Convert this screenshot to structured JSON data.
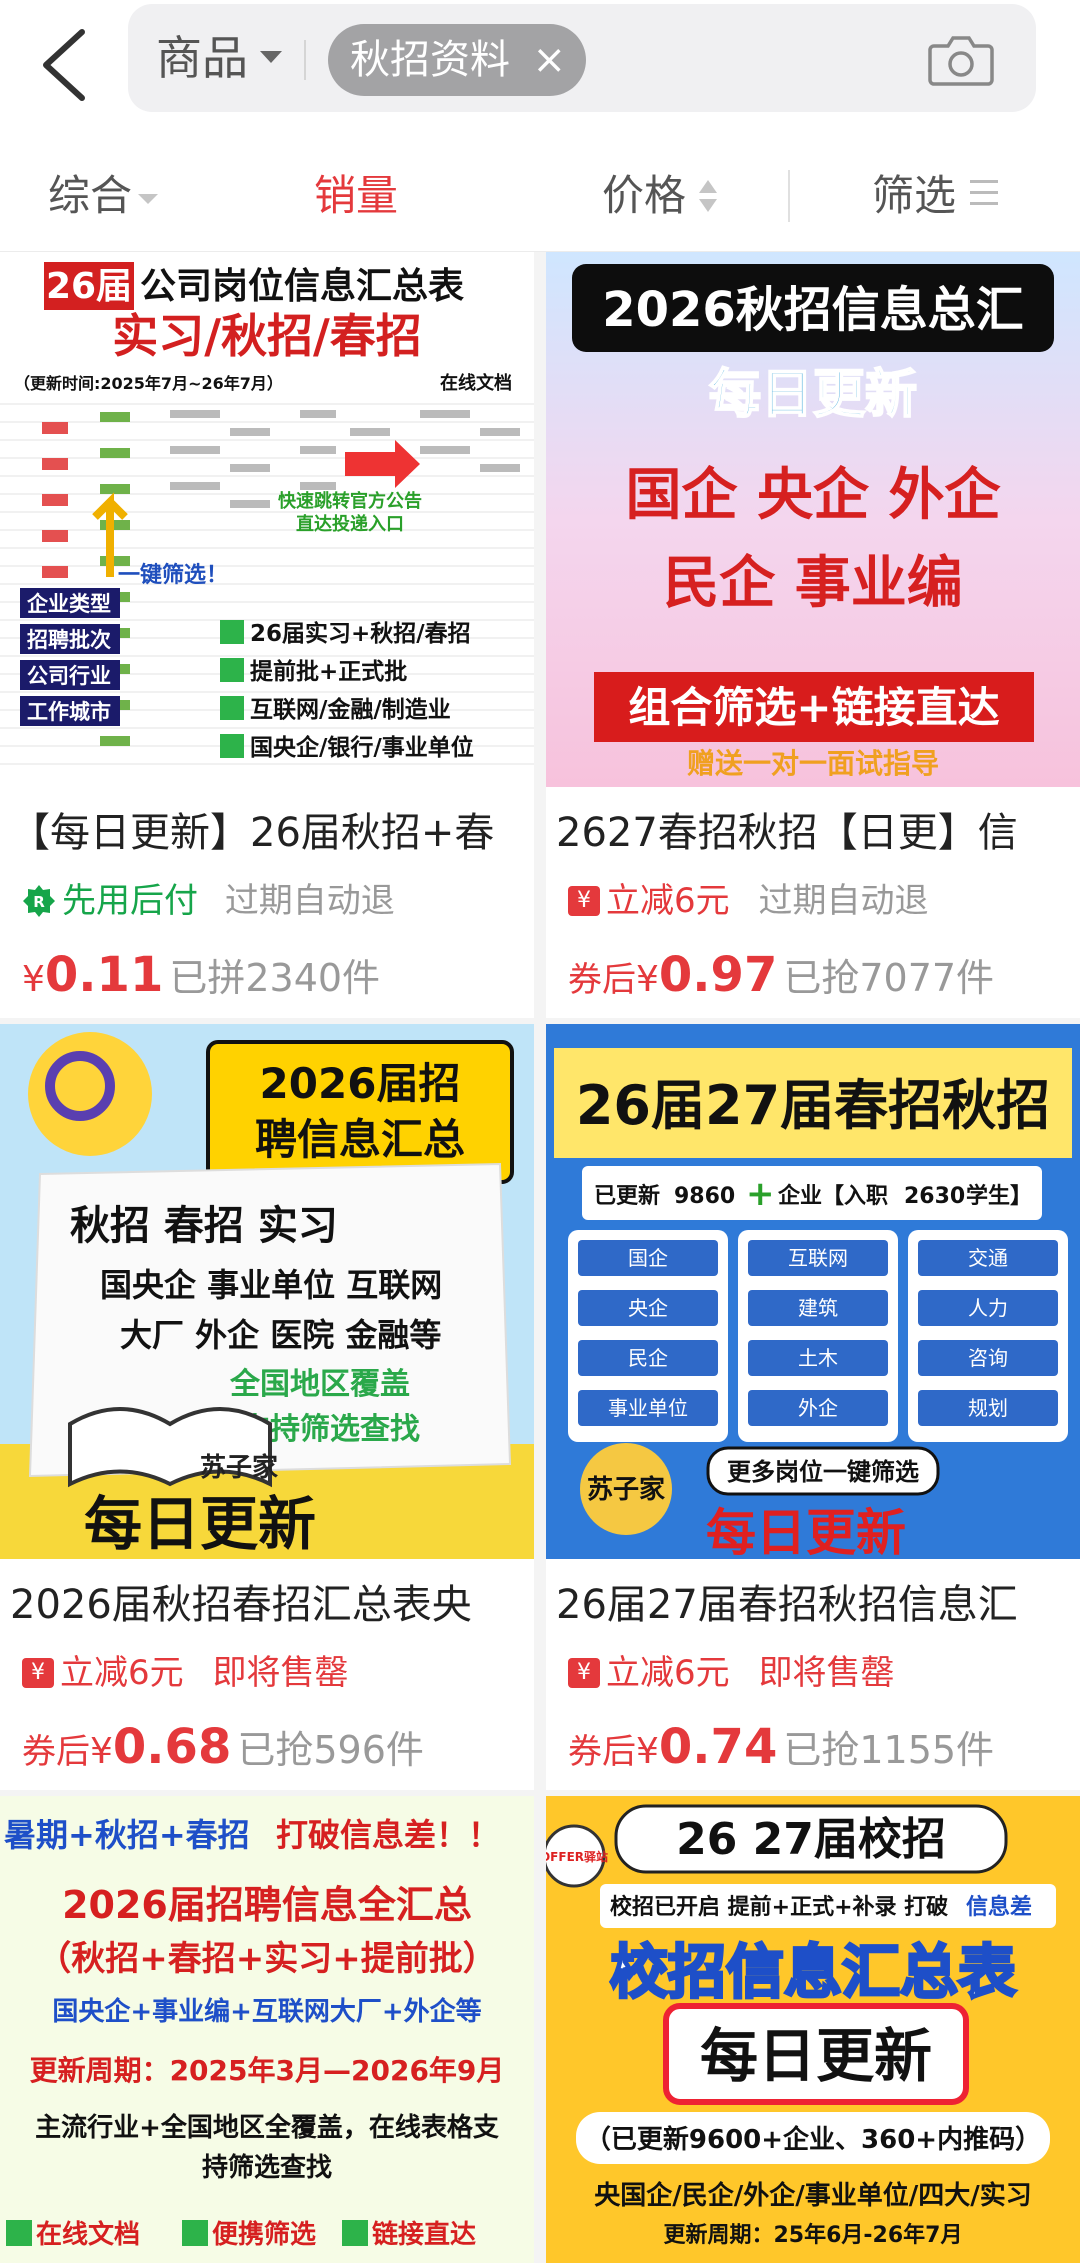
{
  "search": {
    "category": "商品",
    "tag": "秋招资料",
    "tag_close": "×"
  },
  "sort": {
    "tabs": [
      {
        "label": "综合"
      },
      {
        "label": "销量"
      },
      {
        "label": "价格"
      },
      {
        "label": "筛选"
      }
    ],
    "active": "销量"
  },
  "colors": {
    "accent": "#e4393c",
    "green": "#16a54a",
    "gray": "#999999"
  },
  "products": [
    {
      "title": "【每日更新】26届秋招+春",
      "badge": "先用后付",
      "badge2": "过期自动退",
      "price_prefix": "",
      "currency": "¥",
      "price": "0.11",
      "sold": "已拼2340件",
      "image": {
        "top_badge": "26届",
        "top_text": "公司岗位信息汇总表",
        "sub": "实习/秋招/春招",
        "update": "（更新时间:2025年7月~26年7月）",
        "online": "在线文档",
        "arrow_note": "快速跳转官方公告",
        "arrow_note2": "直达投递入口",
        "filter": "一键筛选！",
        "left_items": [
          "企业类型",
          "招聘批次",
          "公司行业",
          "工作城市"
        ],
        "checks": [
          "26届实习+秋招/春招",
          "提前批+正式批",
          "互联网/金融/制造业",
          "国央企/银行/事业单位"
        ]
      }
    },
    {
      "title": "2627春招秋招【日更】信",
      "badge": "立减6元",
      "badge2": "过期自动退",
      "price_prefix": "券后",
      "currency": "¥",
      "price": "0.97",
      "sold": "已抢7077件",
      "image": {
        "header": "2026秋招信息总汇",
        "daily": "每日更新",
        "line1": "国企  央企  外企",
        "line2": "民企  事业编",
        "banner": "组合筛选+链接直达",
        "gift": "赠送一对一面试指导"
      }
    },
    {
      "title": "2026届秋招春招汇总表央",
      "badge": "立减6元",
      "badge2": "即将售罄",
      "price_prefix": "券后",
      "currency": "¥",
      "price": "0.68",
      "sold": "已抢596件",
      "image": {
        "head1": "2026届招",
        "head2": "聘信息汇总",
        "l1": "秋招 春招 实习",
        "l2": "国央企 事业单位 互联网",
        "l3": "大厂 外企 医院 金融等",
        "l4": "全国地区覆盖",
        "l5": "支持筛选查找",
        "brand": "苏子家",
        "daily": "每日更新"
      }
    },
    {
      "title": "26届27届春招秋招信息汇",
      "badge": "立减6元",
      "badge2": "即将售罄",
      "price_prefix": "券后",
      "currency": "¥",
      "price": "0.74",
      "sold": "已抢1155件",
      "image": {
        "header": "26届27届春招秋招",
        "updated_label": "已更新",
        "updated_num": "9860",
        "plus": "+",
        "company": "企业【入职",
        "students": "2630",
        "students_label": "学生】",
        "col1": [
          "国企",
          "央企",
          "民企",
          "事业单位"
        ],
        "col2": [
          "互联网",
          "建筑",
          "土木",
          "外企"
        ],
        "col3": [
          "交通",
          "人力",
          "咨询",
          "规划"
        ],
        "brand": "苏子家",
        "more": "更多岗位一键筛选",
        "daily": "每日更新"
      }
    },
    {
      "image": {
        "l1a": "暑期+秋招+春招",
        "l1b": "打破信息差！！",
        "l2": "2026届招聘信息全汇总",
        "l3": "（秋招+春招+实习+提前批）",
        "l4": "国央企+事业编+互联网大厂+外企等",
        "l5": "更新周期：2025年3月—2026年9月",
        "l6": "主流行业+全国地区全覆盖，在线表格支",
        "l7": "持筛选查找",
        "checks": [
          "在线文档",
          "便携筛选",
          "链接直达"
        ]
      }
    },
    {
      "image": {
        "head": "26 27届校招",
        "stamp": "OFFER驿站",
        "line": "校招已开启 提前+正式+补录 打破",
        "hl": "信息差",
        "big": "校招信息汇总表",
        "daily": "每日更新",
        "updated": "（已更新9600+企业、360+内推码）",
        "cats": "央国企/民企/外企/事业单位/四大/实习",
        "period": "更新周期：25年6月-26年7月"
      }
    }
  ]
}
